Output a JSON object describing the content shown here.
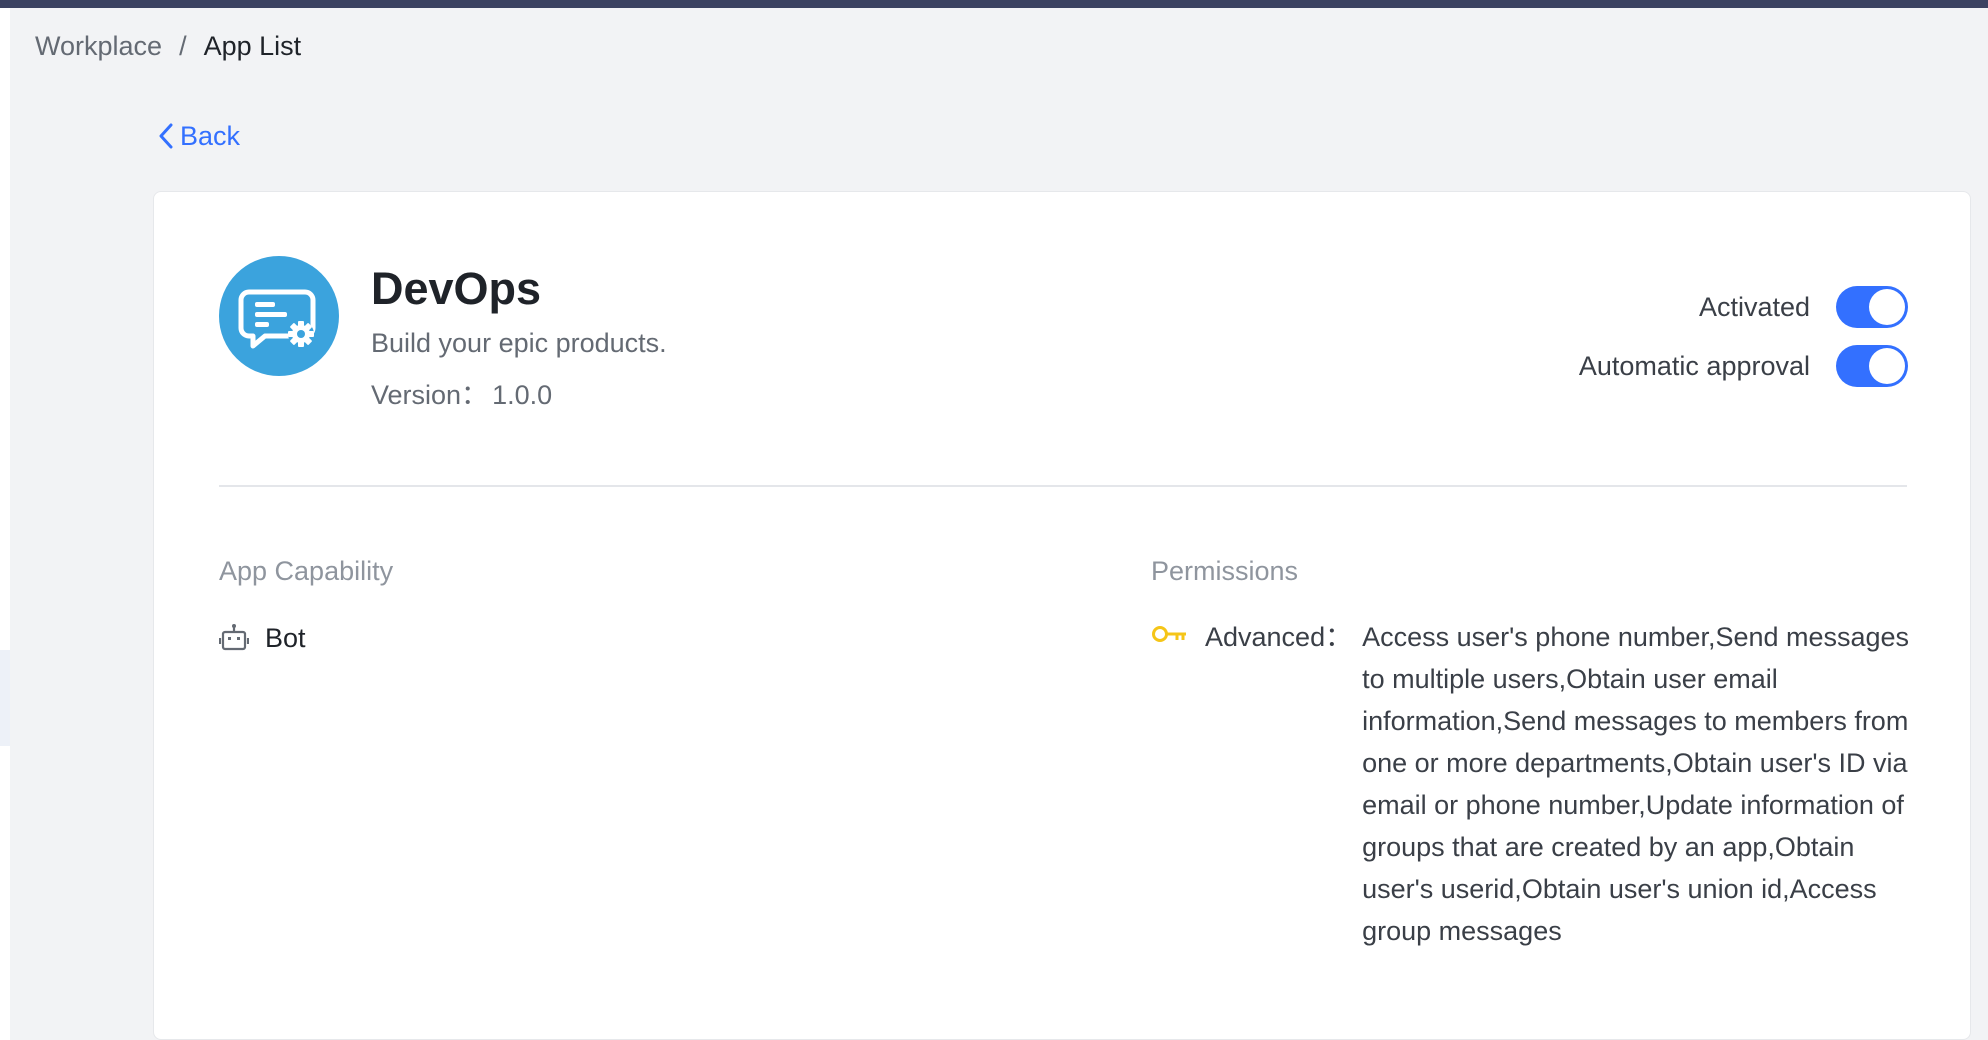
{
  "breadcrumb": {
    "items": [
      "Workplace",
      "App List"
    ],
    "separator": "/"
  },
  "back": {
    "label": "Back"
  },
  "app": {
    "name": "DevOps",
    "description": "Build your epic products.",
    "version_label": "Version：",
    "version": "1.0.0",
    "logo_icon": "chat-bot-gear-icon",
    "logo_color": "#3ba3dd"
  },
  "toggles": [
    {
      "label": "Activated",
      "on": true
    },
    {
      "label": "Automatic approval",
      "on": true
    }
  ],
  "capability": {
    "title": "App Capability",
    "items": [
      {
        "label": "Bot",
        "icon": "robot-icon"
      }
    ]
  },
  "permissions": {
    "title": "Permissions",
    "items": [
      {
        "label": "Advanced：",
        "icon": "key-icon",
        "icon_color": "#f5c518",
        "text": "Access user's phone number,Send messages to multiple users,Obtain user email information,Send messages to members from one or more departments,Obtain user's ID via email or phone number,Update information of groups that are created by an app,Obtain user's userid,Obtain user's union id,Access group messages"
      }
    ]
  },
  "colors": {
    "accent": "#3370ff",
    "topbar": "#3b4261",
    "background": "#f2f3f5"
  }
}
